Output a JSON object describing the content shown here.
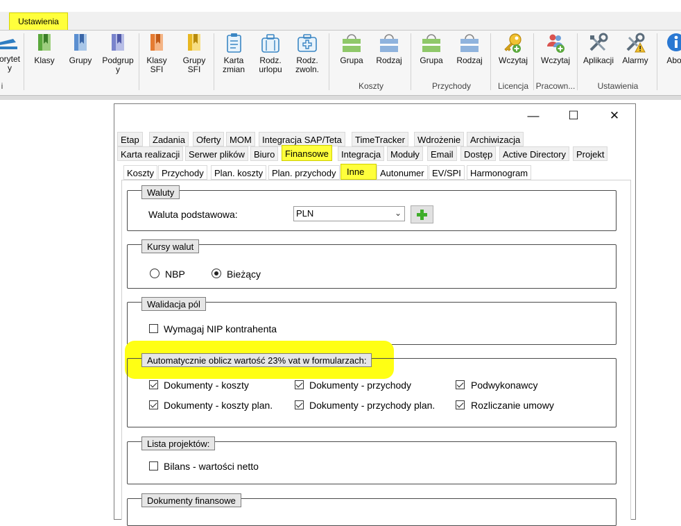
{
  "ribbon": {
    "active_tab": "Ustawienia",
    "buttons": [
      {
        "label": "orytet\ny",
        "icon": "partial-icon"
      },
      {
        "label": "Klasy",
        "icon": "bookmark-green-icon"
      },
      {
        "label": "Grupy",
        "icon": "bookmark-blue-icon"
      },
      {
        "label": "Podgrup\ny",
        "icon": "bookmark-purple-icon"
      },
      {
        "label": "Klasy\nSFI",
        "icon": "bookmark-orange-icon"
      },
      {
        "label": "Grupy\nSFI",
        "icon": "bookmark-yellow-icon"
      },
      {
        "label": "Karta\nzmian",
        "icon": "clipboard-icon"
      },
      {
        "label": "Rodz.\nurlopu",
        "icon": "luggage-icon"
      },
      {
        "label": "Rodz.\nzwoln.",
        "icon": "first-aid-icon"
      },
      {
        "label": "Grupa",
        "icon": "green-box-icon"
      },
      {
        "label": "Rodzaj",
        "icon": "blue-box-icon"
      },
      {
        "label": "Grupa",
        "icon": "green-box-icon"
      },
      {
        "label": "Rodzaj",
        "icon": "blue-box-icon"
      },
      {
        "label": "Wczytaj",
        "icon": "key-icon"
      },
      {
        "label": "Wczytaj",
        "icon": "users-add-icon"
      },
      {
        "label": "Aplikacji",
        "icon": "tools-icon"
      },
      {
        "label": "Alarmy",
        "icon": "tools-warning-icon"
      },
      {
        "label": "Abo",
        "icon": "info-icon"
      }
    ],
    "groups": {
      "left_cut": "i",
      "koszty": "Koszty",
      "przychody": "Przychody",
      "licencja": "Licencja",
      "pracown": "Pracown...",
      "ustawienia": "Ustawienia"
    }
  },
  "window": {
    "minimize": "—",
    "maximize": "☐",
    "close": "✕"
  },
  "tabs_row1": [
    "Etap",
    "Zadania",
    "Oferty",
    "MOM",
    "Integracja SAP/Teta",
    "TimeTracker",
    "Wdrożenie",
    "Archiwizacja"
  ],
  "tabs_row2": [
    "Karta realizacji",
    "Serwer plików",
    "Biuro",
    "Finansowe",
    "Integracja",
    "Moduły",
    "Email",
    "Dostęp",
    "Active Directory",
    "Projekt"
  ],
  "tabs_row3": [
    "Koszty",
    "Przychody",
    "Plan. koszty",
    "Plan. przychody",
    "Inne",
    "Autonumer",
    "EV/SPI",
    "Harmonogram"
  ],
  "sections": {
    "waluty": {
      "title": "Waluty",
      "label": "Waluta podstawowa:",
      "value": "PLN",
      "add_symbol": "+"
    },
    "kursy": {
      "title": "Kursy walut",
      "options": [
        {
          "label": "NBP",
          "selected": false
        },
        {
          "label": "Bieżący",
          "selected": true
        }
      ]
    },
    "walidacja": {
      "title": "Walidacja pól",
      "items": [
        {
          "label": "Wymagaj NIP kontrahenta",
          "checked": false
        }
      ]
    },
    "vat": {
      "title": "Automatycznie oblicz wartość 23% vat  w formularzach:",
      "items": [
        {
          "label": "Dokumenty - koszty",
          "checked": true
        },
        {
          "label": "Dokumenty - przychody",
          "checked": true
        },
        {
          "label": "Podwykonawcy",
          "checked": true
        },
        {
          "label": "Dokumenty - koszty plan.",
          "checked": true
        },
        {
          "label": "Dokumenty - przychody plan.",
          "checked": true
        },
        {
          "label": "Rozliczanie umowy",
          "checked": true
        }
      ]
    },
    "lista": {
      "title": "Lista projektów:",
      "items": [
        {
          "label": "Bilans - wartości netto",
          "checked": false
        }
      ]
    },
    "dokumenty": {
      "title": "Dokumenty finansowe"
    }
  },
  "colors": {
    "highlight": "#ffff14",
    "ribbon_tab": "#ffff3c"
  }
}
